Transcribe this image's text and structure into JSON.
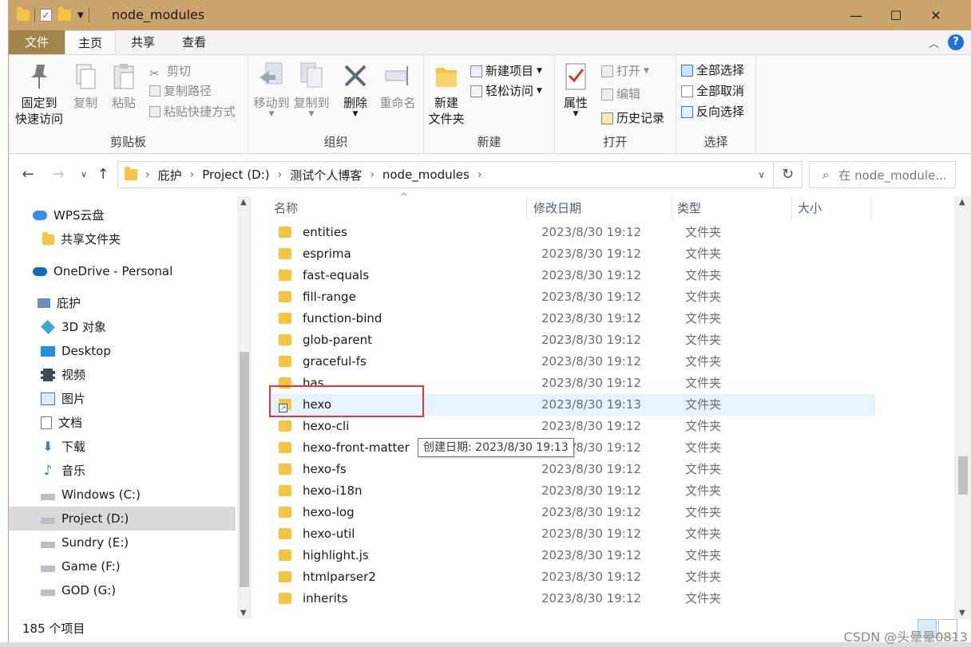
{
  "window": {
    "title": "node_modules",
    "controls": {
      "minimize": "—",
      "maximize": "☐",
      "close": "✕"
    }
  },
  "ribbon_tabs": {
    "file": "文件",
    "home": "主页",
    "share": "共享",
    "view": "查看"
  },
  "ribbon": {
    "clipboard": {
      "label": "剪贴板",
      "pin_line1": "固定到",
      "pin_line2": "快速访问",
      "copy": "复制",
      "paste": "粘贴",
      "cut": "剪切",
      "copy_path": "复制路径",
      "paste_shortcut": "粘贴快捷方式"
    },
    "organize": {
      "label": "组织",
      "move_to": "移动到",
      "copy_to": "复制到",
      "delete": "删除",
      "rename": "重命名"
    },
    "new": {
      "label": "新建",
      "new_folder_line1": "新建",
      "new_folder_line2": "文件夹",
      "new_item": "新建项目",
      "easy_access": "轻松访问"
    },
    "open": {
      "label": "打开",
      "properties": "属性",
      "open": "打开",
      "edit": "编辑",
      "history": "历史记录"
    },
    "select": {
      "label": "选择",
      "select_all": "全部选择",
      "select_none": "全部取消",
      "invert": "反向选择"
    }
  },
  "address": {
    "crumbs": [
      "庇护",
      "Project (D:)",
      "测试个人博客",
      "node_modules"
    ],
    "search_placeholder": "在 node_module..."
  },
  "nav": {
    "items": [
      {
        "label": "WPS云盘"
      },
      {
        "label": "共享文件夹"
      },
      {
        "label": "OneDrive - Personal"
      },
      {
        "label": "庇护"
      },
      {
        "label": "3D 对象"
      },
      {
        "label": "Desktop"
      },
      {
        "label": "视频"
      },
      {
        "label": "图片"
      },
      {
        "label": "文档"
      },
      {
        "label": "下载"
      },
      {
        "label": "音乐"
      },
      {
        "label": "Windows (C:)"
      },
      {
        "label": "Project (D:)"
      },
      {
        "label": "Sundry (E:)"
      },
      {
        "label": "Game (F:)"
      },
      {
        "label": "GOD (G:)"
      }
    ]
  },
  "columns": {
    "name": "名称",
    "date": "修改日期",
    "type": "类型",
    "size": "大小"
  },
  "files": [
    {
      "name": "entities",
      "date": "2023/8/30 19:12",
      "type": "文件夹"
    },
    {
      "name": "esprima",
      "date": "2023/8/30 19:12",
      "type": "文件夹"
    },
    {
      "name": "fast-equals",
      "date": "2023/8/30 19:12",
      "type": "文件夹"
    },
    {
      "name": "fill-range",
      "date": "2023/8/30 19:12",
      "type": "文件夹"
    },
    {
      "name": "function-bind",
      "date": "2023/8/30 19:12",
      "type": "文件夹"
    },
    {
      "name": "glob-parent",
      "date": "2023/8/30 19:12",
      "type": "文件夹"
    },
    {
      "name": "graceful-fs",
      "date": "2023/8/30 19:12",
      "type": "文件夹"
    },
    {
      "name": "has",
      "date": "2023/8/30 19:12",
      "type": "文件夹"
    },
    {
      "name": "hexo",
      "date": "2023/8/30 19:13",
      "type": "文件夹"
    },
    {
      "name": "hexo-cli",
      "date": "2023/8/30 19:12",
      "type": "文件夹"
    },
    {
      "name": "hexo-front-matter",
      "date": "2023/8/30 19:12",
      "type": "文件夹"
    },
    {
      "name": "hexo-fs",
      "date": "2023/8/30 19:12",
      "type": "文件夹"
    },
    {
      "name": "hexo-i18n",
      "date": "2023/8/30 19:12",
      "type": "文件夹"
    },
    {
      "name": "hexo-log",
      "date": "2023/8/30 19:12",
      "type": "文件夹"
    },
    {
      "name": "hexo-util",
      "date": "2023/8/30 19:12",
      "type": "文件夹"
    },
    {
      "name": "highlight.js",
      "date": "2023/8/30 19:12",
      "type": "文件夹"
    },
    {
      "name": "htmlparser2",
      "date": "2023/8/30 19:12",
      "type": "文件夹"
    },
    {
      "name": "inherits",
      "date": "2023/8/30 19:12",
      "type": "文件夹"
    }
  ],
  "tooltip": "创建日期: 2023/8/30 19:13",
  "status": {
    "count": "185 个项目"
  },
  "watermark": "CSDN @头晕晕0813",
  "colors": {
    "title_bar": "#c9a46c",
    "file_tab": "#a2834c",
    "selection": "#e5f3ff",
    "highlight_box": "#e53935"
  }
}
